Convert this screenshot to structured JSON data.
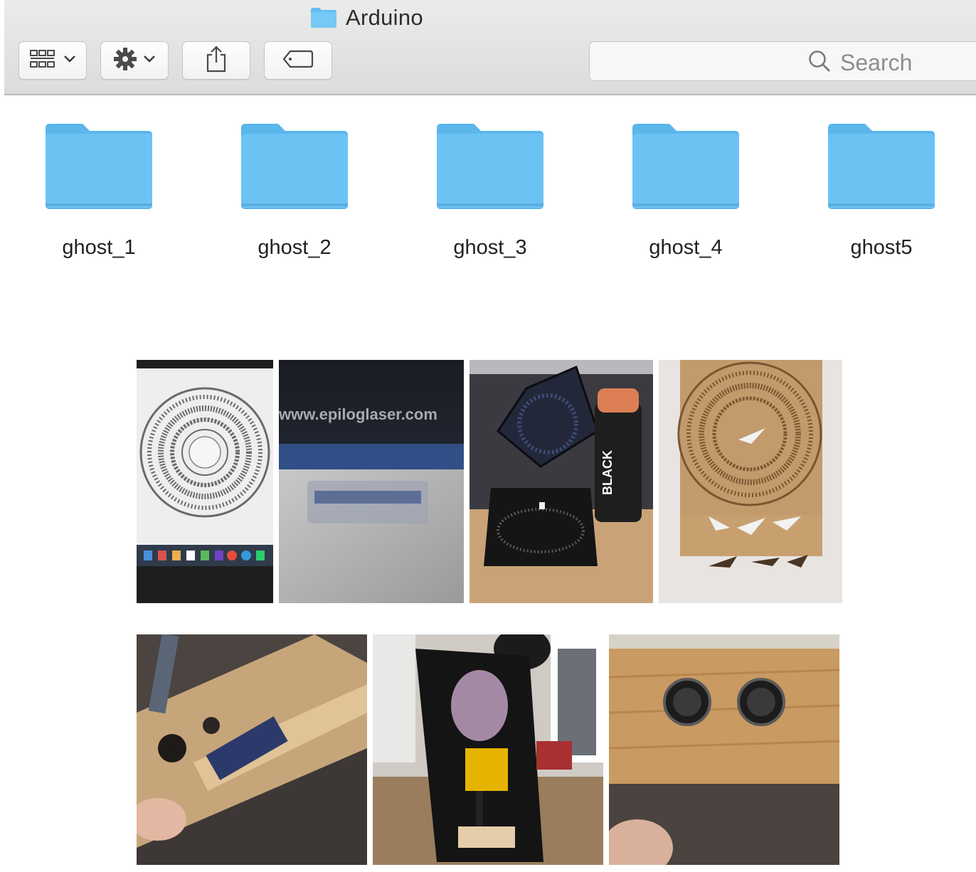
{
  "window": {
    "title": "Arduino"
  },
  "toolbar": {
    "view_button_icon": "icon-view-grid-icon",
    "action_button_icon": "gear-icon",
    "share_button_icon": "share-icon",
    "tag_button_icon": "tag-icon",
    "search_placeholder": "Search"
  },
  "folders": [
    {
      "name": "ghost_1"
    },
    {
      "name": "ghost_2"
    },
    {
      "name": "ghost_3"
    },
    {
      "name": "ghost_4"
    },
    {
      "name": "ghost5"
    }
  ],
  "photos": {
    "row1": [
      {
        "subject": "laser-cut-design-on-laptop-screen"
      },
      {
        "subject": "epilog-laser-cutter",
        "visible_text": "www.epiloglaser.com"
      },
      {
        "subject": "painted-panel-with-spray-can",
        "visible_text": "BLACK"
      },
      {
        "subject": "engraved-cardboard-dial"
      }
    ],
    "row2": [
      {
        "subject": "sensor-mounted-in-wood"
      },
      {
        "subject": "student-drilling-wood"
      },
      {
        "subject": "ultrasonic-sensor-eyes-in-wood"
      }
    ]
  },
  "colors": {
    "folder_blue": "#6cc3f3",
    "folder_tab": "#5bb6ec",
    "toolbar_bg": "#e3e3e3"
  }
}
